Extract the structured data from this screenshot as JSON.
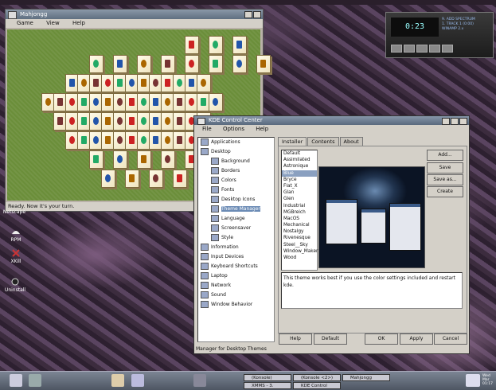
{
  "mahjongg": {
    "title": "Mahjongg",
    "menu": [
      "Game",
      "View",
      "Help"
    ],
    "status": "Ready. Now it's your turn."
  },
  "winamp": {
    "time": "0:23",
    "ticker": [
      "9. ADD SPECTRUM",
      "1. TRACK 1 (0:00)",
      "WINAMP 2.x"
    ]
  },
  "desktop_icons": [
    {
      "label": "Netscape",
      "icon": "browser-icon"
    },
    {
      "label": "RPM",
      "icon": "package-icon"
    },
    {
      "label": "XKill",
      "icon": "kill-icon"
    },
    {
      "label": "Uninstall",
      "icon": "uninstall-icon"
    }
  ],
  "kcc": {
    "title": "KDE Control Center",
    "menu": [
      "File",
      "Options",
      "Help"
    ],
    "tree": [
      {
        "label": "Applications",
        "indent": 0,
        "icon": "applications-icon"
      },
      {
        "label": "Desktop",
        "indent": 0,
        "icon": "desktop-icon"
      },
      {
        "label": "Background",
        "indent": 1,
        "icon": "background-icon"
      },
      {
        "label": "Borders",
        "indent": 1,
        "icon": "borders-icon"
      },
      {
        "label": "Colors",
        "indent": 1,
        "icon": "colors-icon"
      },
      {
        "label": "Fonts",
        "indent": 1,
        "icon": "fonts-icon"
      },
      {
        "label": "Desktop Icons",
        "indent": 1,
        "icon": "desktop-icons-icon"
      },
      {
        "label": "Theme Manager",
        "indent": 1,
        "icon": "theme-manager-icon",
        "selected": true
      },
      {
        "label": "Language",
        "indent": 1,
        "icon": "language-icon"
      },
      {
        "label": "Screensaver",
        "indent": 1,
        "icon": "screensaver-icon"
      },
      {
        "label": "Style",
        "indent": 1,
        "icon": "style-icon"
      },
      {
        "label": "Information",
        "indent": 0,
        "icon": "information-icon"
      },
      {
        "label": "Input Devices",
        "indent": 0,
        "icon": "input-devices-icon"
      },
      {
        "label": "Keyboard Shortcuts",
        "indent": 0,
        "icon": "keyboard-icon"
      },
      {
        "label": "Laptop",
        "indent": 0,
        "icon": "laptop-icon"
      },
      {
        "label": "Network",
        "indent": 0,
        "icon": "network-icon"
      },
      {
        "label": "Sound",
        "indent": 0,
        "icon": "sound-icon"
      },
      {
        "label": "Window Behavior",
        "indent": 0,
        "icon": "window-behavior-icon"
      }
    ],
    "tabs": [
      "Installer",
      "Contents",
      "About"
    ],
    "themes": [
      "Default",
      "Assimilated",
      "Astronique",
      "Blue",
      "Bryce",
      "Flat_X",
      "Glan",
      "Glen",
      "Industrial",
      "MGBreich",
      "MacOS",
      "Mechanical",
      "Nostalgy",
      "Rivenesque",
      "Steel__Sky",
      "Window_Maker",
      "Wood"
    ],
    "selected_theme": "Blue",
    "side_buttons": [
      "Add...",
      "Save",
      "Save as...",
      "Create"
    ],
    "description": "This theme works best if you use the color settings included and restart kde.",
    "bottom_buttons": [
      "Help",
      "Default",
      "OK",
      "Apply",
      "Cancel"
    ],
    "footer": "Manager for Desktop Themes"
  },
  "taskbar": {
    "tasks": [
      "(Konsole)",
      "(Konsole <2>)",
      "Mahjongg",
      "XMMS - 3.",
      "KDE Control"
    ],
    "clock": [
      "Wed",
      "Mar",
      "01:17"
    ]
  },
  "colors": {
    "felt": "#6b8e3a",
    "selection": "#6b8bb5",
    "titlebar": "#5f6f80"
  }
}
